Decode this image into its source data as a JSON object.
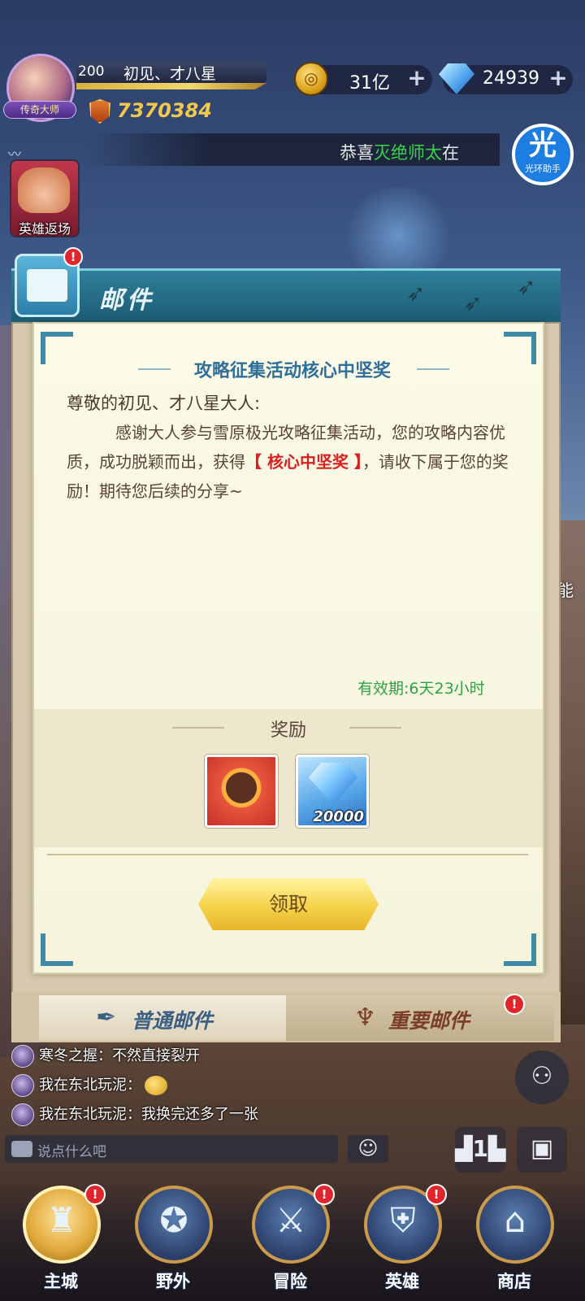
{
  "player": {
    "avatar_title": "传奇大师",
    "level": "200",
    "name": "初见、才八星",
    "power": "7370384"
  },
  "resources": {
    "gold": "31亿",
    "gems": "24939",
    "plus": "+"
  },
  "broadcast": {
    "prefix": "恭喜",
    "highlight": "灭绝师太",
    "suffix": "在"
  },
  "assistant": {
    "char": "光",
    "label": "光环助手"
  },
  "hero_return": {
    "label": "英雄返场"
  },
  "side_text": "能",
  "mail": {
    "title": "邮件",
    "badge": "!",
    "subject": "攻略征集活动核心中坚奖",
    "salutation": "尊敬的初见、才八星大人:",
    "body_part1": "感谢大人参与雪原极光攻略征集活动，您的攻略内容优质，成功脱颖而出，获得",
    "body_highlight": "【 核心中坚奖 】",
    "body_part2": "，请收下属于您的奖励！期待您后续的分享~",
    "validity": "有效期:6天23小时",
    "reward_title": "奖励",
    "rewards": [
      {
        "icon": "avatar-frame-icon",
        "count": ""
      },
      {
        "icon": "diamond-icon",
        "count": "20000"
      }
    ],
    "claim_label": "领取",
    "tabs": [
      {
        "label": "普通邮件",
        "icon": "quill-icon"
      },
      {
        "label": "重要邮件",
        "icon": "balloon-icon",
        "badge": "!"
      }
    ]
  },
  "chat": {
    "messages": [
      {
        "text": "寒冬之握：不然直接裂开"
      },
      {
        "text": "我在东北玩泥："
      },
      {
        "text": "我在东北玩泥：我换完还多了一张"
      }
    ],
    "placeholder": "说点什么吧"
  },
  "nav": {
    "items": [
      {
        "label": "主城",
        "glyph": "♜",
        "badge": "!"
      },
      {
        "label": "野外",
        "glyph": "✪",
        "badge": ""
      },
      {
        "label": "冒险",
        "glyph": "⚔",
        "badge": "!"
      },
      {
        "label": "英雄",
        "glyph": "⛨",
        "badge": "!"
      },
      {
        "label": "商店",
        "glyph": "⌂",
        "badge": ""
      }
    ]
  },
  "colors": {
    "accent_blue": "#2f6f9a",
    "highlight_red": "#d91f1f",
    "validity_green": "#2ea346",
    "broadcast_green": "#38d14a",
    "badge_red": "#e0252c"
  }
}
